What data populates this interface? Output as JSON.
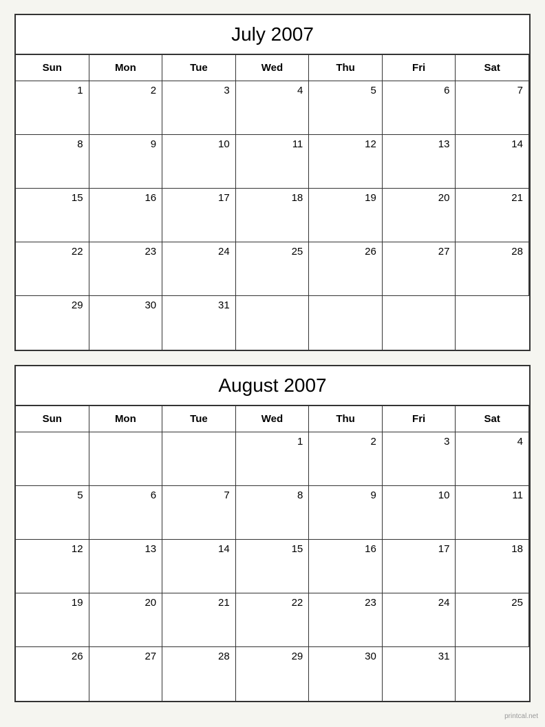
{
  "july": {
    "title": "July 2007",
    "headers": [
      "Sun",
      "Mon",
      "Tue",
      "Wed",
      "Thu",
      "Fri",
      "Sat"
    ],
    "weeks": [
      [
        {
          "day": "",
          "empty": true
        },
        {
          "day": "",
          "empty": true
        },
        {
          "day": "",
          "empty": true
        },
        {
          "day": "",
          "empty": true
        },
        {
          "day": "",
          "empty": true
        },
        {
          "day": "",
          "empty": true
        },
        {
          "day": "1",
          "empty": false
        }
      ],
      [
        {
          "day": "8",
          "empty": false
        },
        {
          "day": "9",
          "empty": false
        },
        {
          "day": "10",
          "empty": false
        },
        {
          "day": "11",
          "empty": false
        },
        {
          "day": "12",
          "empty": false
        },
        {
          "day": "13",
          "empty": false
        },
        {
          "day": "14",
          "empty": false
        }
      ],
      [
        {
          "day": "15",
          "empty": false
        },
        {
          "day": "16",
          "empty": false
        },
        {
          "day": "17",
          "empty": false
        },
        {
          "day": "18",
          "empty": false
        },
        {
          "day": "19",
          "empty": false
        },
        {
          "day": "20",
          "empty": false
        },
        {
          "day": "21",
          "empty": false
        }
      ],
      [
        {
          "day": "22",
          "empty": false
        },
        {
          "day": "23",
          "empty": false
        },
        {
          "day": "24",
          "empty": false
        },
        {
          "day": "25",
          "empty": false
        },
        {
          "day": "26",
          "empty": false
        },
        {
          "day": "27",
          "empty": false
        },
        {
          "day": "28",
          "empty": false
        }
      ],
      [
        {
          "day": "29",
          "empty": false
        },
        {
          "day": "30",
          "empty": false
        },
        {
          "day": "31",
          "empty": false
        },
        {
          "day": "",
          "empty": true
        },
        {
          "day": "",
          "empty": true
        },
        {
          "day": "",
          "empty": true
        },
        {
          "day": "",
          "empty": true
        }
      ]
    ],
    "week1": [
      {
        "day": "",
        "empty": true
      },
      {
        "day": "",
        "empty": true
      },
      {
        "day": "",
        "empty": true
      },
      {
        "day": "",
        "empty": true
      },
      {
        "day": "",
        "empty": true
      },
      {
        "day": "",
        "empty": true
      },
      {
        "day": "1",
        "empty": false
      }
    ],
    "week1_extra": [
      {
        "day": "2",
        "empty": false
      },
      {
        "day": "3",
        "empty": false
      },
      {
        "day": "4",
        "empty": false
      },
      {
        "day": "5",
        "empty": false
      },
      {
        "day": "6",
        "empty": false
      },
      {
        "day": "7",
        "empty": false
      }
    ]
  },
  "august": {
    "title": "August 2007",
    "headers": [
      "Sun",
      "Mon",
      "Tue",
      "Wed",
      "Thu",
      "Fri",
      "Sat"
    ],
    "weeks": [
      [
        {
          "day": "",
          "empty": true
        },
        {
          "day": "",
          "empty": true
        },
        {
          "day": "",
          "empty": true
        },
        {
          "day": "1",
          "empty": false
        },
        {
          "day": "2",
          "empty": false
        },
        {
          "day": "3",
          "empty": false
        },
        {
          "day": "4",
          "empty": false
        }
      ],
      [
        {
          "day": "5",
          "empty": false
        },
        {
          "day": "6",
          "empty": false
        },
        {
          "day": "7",
          "empty": false
        },
        {
          "day": "8",
          "empty": false
        },
        {
          "day": "9",
          "empty": false
        },
        {
          "day": "10",
          "empty": false
        },
        {
          "day": "11",
          "empty": false
        }
      ],
      [
        {
          "day": "12",
          "empty": false
        },
        {
          "day": "13",
          "empty": false
        },
        {
          "day": "14",
          "empty": false
        },
        {
          "day": "15",
          "empty": false
        },
        {
          "day": "16",
          "empty": false
        },
        {
          "day": "17",
          "empty": false
        },
        {
          "day": "18",
          "empty": false
        }
      ],
      [
        {
          "day": "19",
          "empty": false
        },
        {
          "day": "20",
          "empty": false
        },
        {
          "day": "21",
          "empty": false
        },
        {
          "day": "22",
          "empty": false
        },
        {
          "day": "23",
          "empty": false
        },
        {
          "day": "24",
          "empty": false
        },
        {
          "day": "25",
          "empty": false
        }
      ],
      [
        {
          "day": "26",
          "empty": false
        },
        {
          "day": "27",
          "empty": false
        },
        {
          "day": "28",
          "empty": false
        },
        {
          "day": "29",
          "empty": false
        },
        {
          "day": "30",
          "empty": false
        },
        {
          "day": "31",
          "empty": false
        },
        {
          "day": "",
          "empty": true
        }
      ]
    ]
  },
  "watermark": "printcal.net"
}
